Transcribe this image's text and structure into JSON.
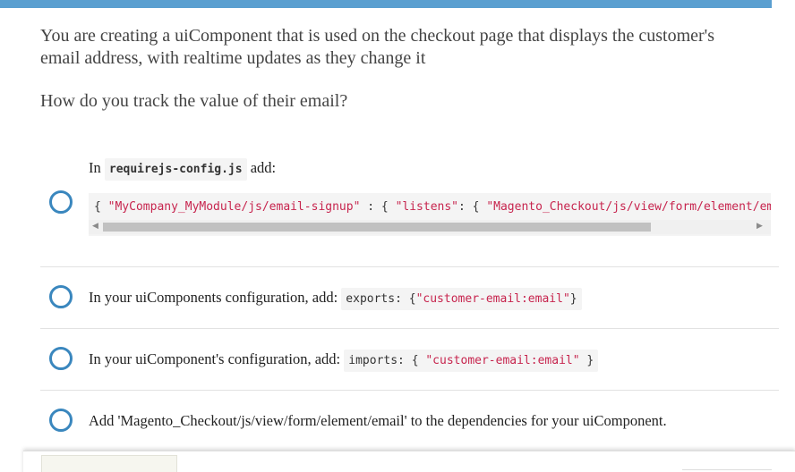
{
  "question": {
    "text": "You are creating a uiComponent that is used on the checkout page that displays the customer's email address, with realtime updates as they change it",
    "prompt": "How do you track the value of their email?"
  },
  "options": [
    {
      "intro_pre": "In ",
      "intro_code": "requirejs-config.js",
      "intro_post": " add:",
      "code_plain_1": "{ ",
      "code_str_1": "\"MyCompany_MyModule/js/email-signup\"",
      "code_plain_2": " : { ",
      "code_str_2": "\"listens\"",
      "code_plain_3": ": { ",
      "code_str_3": "\"Magento_Checkout/js/view/form/element/email"
    },
    {
      "text": "In your uiComponents configuration, add: ",
      "code_plain": "exports: {",
      "code_str": "\"customer-email:email\"",
      "code_end": "}"
    },
    {
      "text": "In your uiComponent's configuration, add: ",
      "code_plain": "imports: { ",
      "code_str": "\"customer-email:email\"",
      "code_end": " }"
    },
    {
      "text": "Add 'Magento_Checkout/js/view/form/element/email' to the dependencies for your uiComponent."
    }
  ],
  "scrollbar": {
    "left_arrow": "◀",
    "right_arrow": "▶"
  },
  "colors": {
    "accent_bar": "#5a9fd0",
    "radio_border": "#3a87be",
    "code_string": "#c7254e"
  }
}
